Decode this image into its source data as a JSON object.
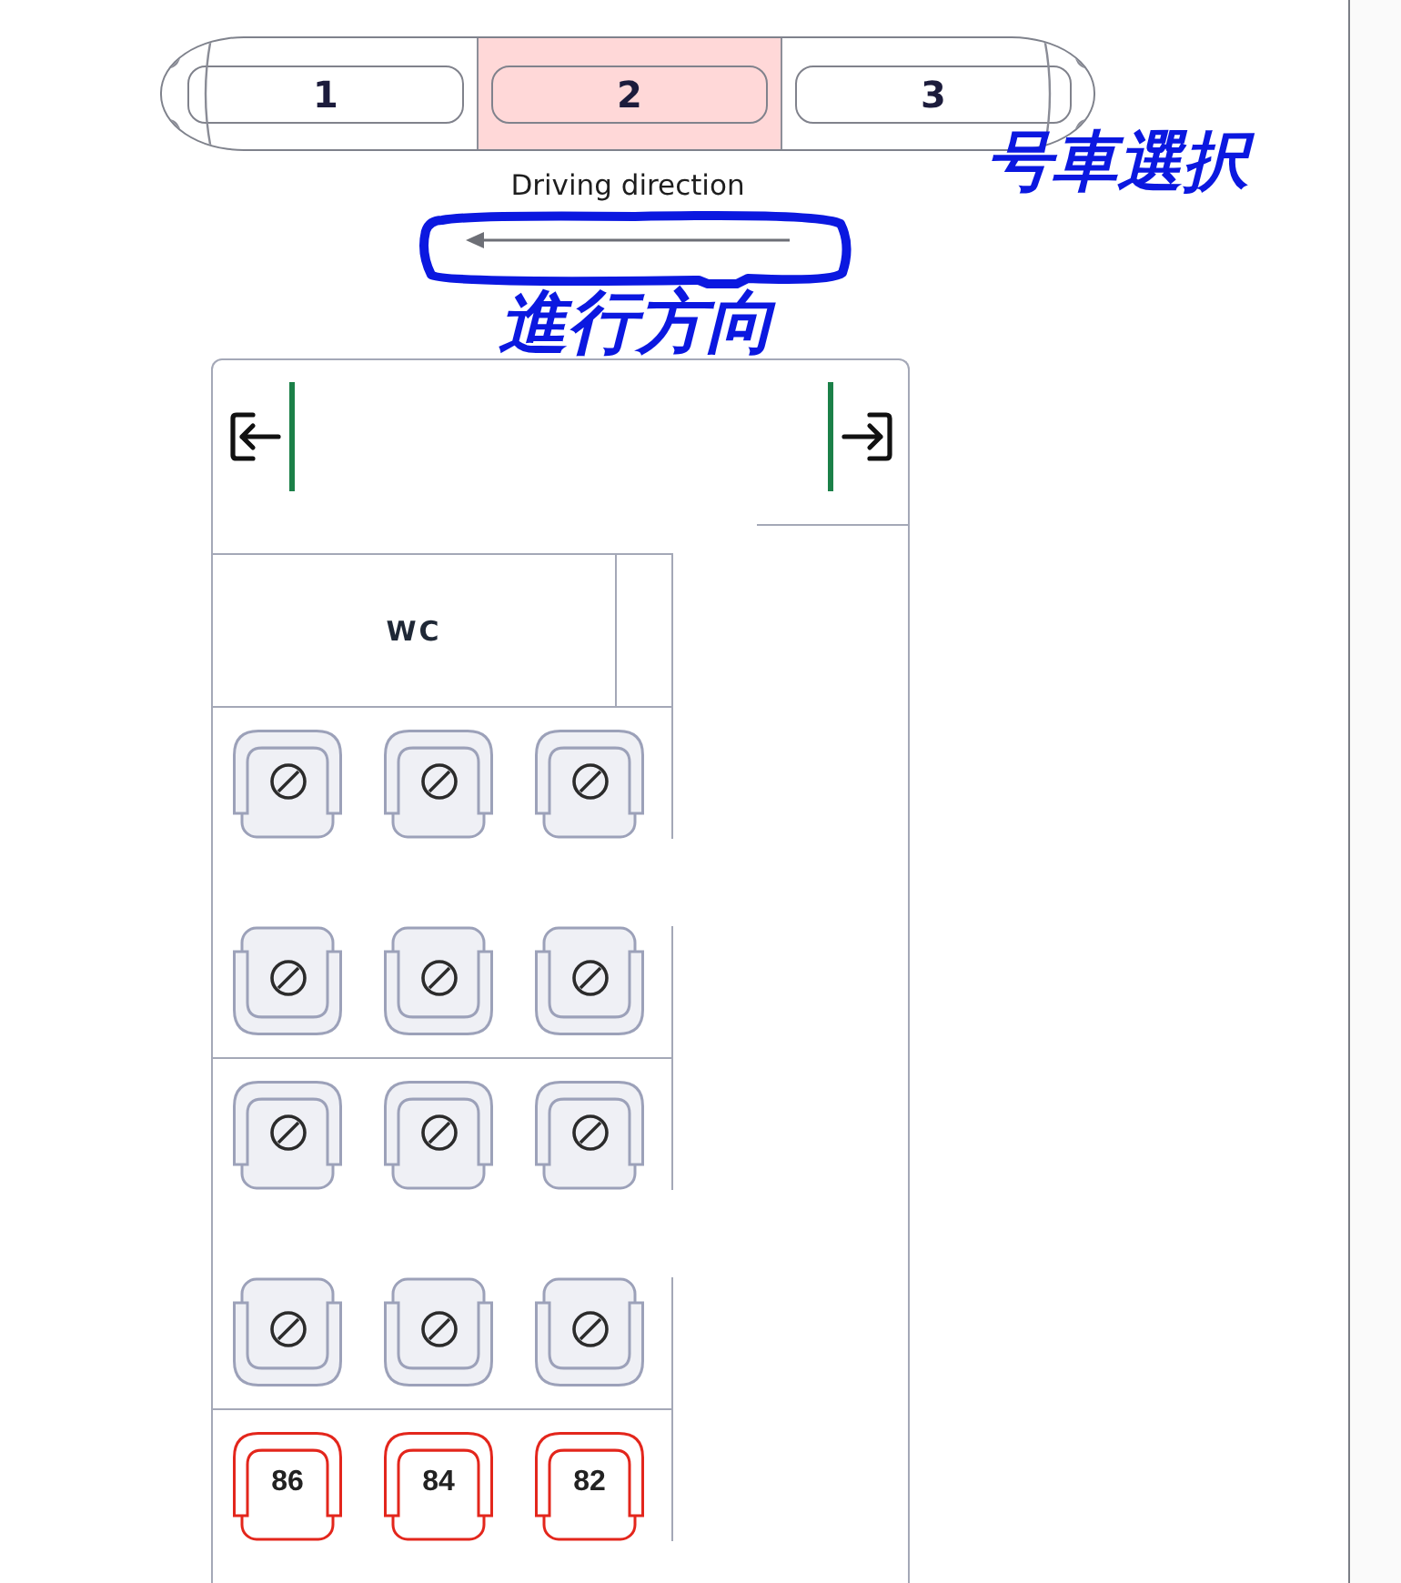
{
  "train": {
    "coaches": [
      {
        "label": "1",
        "selected": false
      },
      {
        "label": "2",
        "selected": true
      },
      {
        "label": "3",
        "selected": false
      }
    ],
    "annotation": "号車選択"
  },
  "direction": {
    "label": "Driving direction",
    "annotation": "進行方向"
  },
  "coach_layout": {
    "toilet": {
      "label": "WC"
    },
    "bays": [
      {
        "rows": [
          {
            "reversed": false,
            "seats": [
              {
                "available": false
              },
              {
                "available": false
              },
              {
                "available": false
              }
            ]
          },
          {
            "reversed": true,
            "seats": [
              {
                "available": false
              },
              {
                "available": false
              },
              {
                "available": false
              }
            ]
          }
        ]
      },
      {
        "rows": [
          {
            "reversed": false,
            "seats": [
              {
                "available": false
              },
              {
                "available": false
              },
              {
                "available": false
              }
            ]
          },
          {
            "reversed": true,
            "seats": [
              {
                "available": false
              },
              {
                "available": false
              },
              {
                "available": false
              }
            ]
          }
        ]
      },
      {
        "rows": [
          {
            "reversed": false,
            "seats": [
              {
                "available": true,
                "label": "86"
              },
              {
                "available": true,
                "label": "84"
              },
              {
                "available": true,
                "label": "82"
              }
            ]
          }
        ]
      }
    ]
  }
}
